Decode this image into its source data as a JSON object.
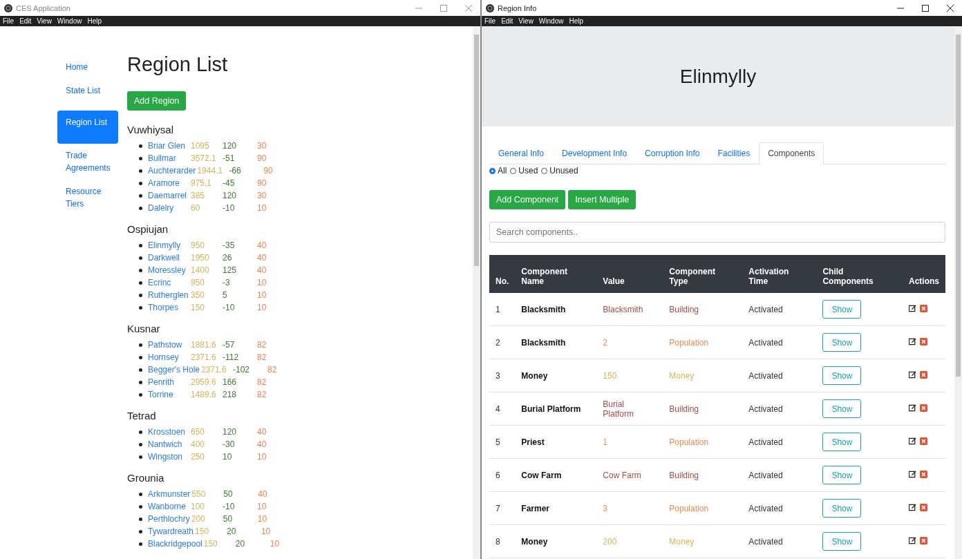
{
  "left_window": {
    "title": "CES Application",
    "menu": [
      "File",
      "Edit",
      "View",
      "Window",
      "Help"
    ],
    "nav": [
      {
        "label": "Home",
        "selected": false
      },
      {
        "label": "State List",
        "selected": false
      },
      {
        "label": "Region List",
        "selected": true
      },
      {
        "label": "Trade Agreements",
        "selected": false
      },
      {
        "label": "Resource Tiers",
        "selected": false
      }
    ],
    "heading": "Region List",
    "add_button": "Add Region",
    "states": [
      {
        "name": "Vuwhiysal",
        "regions": [
          {
            "name": "Briar Glen",
            "column_2": "1095",
            "column_3": "120",
            "column_4": "30"
          },
          {
            "name": "Bullmar",
            "column_2": "3572.1",
            "column_3": "-51",
            "column_4": "90"
          },
          {
            "name": "Auchterarder",
            "column_2": "1944.1",
            "column_3": "-66",
            "column_4": "90"
          },
          {
            "name": "Aramore",
            "column_2": "975.1",
            "column_3": "-45",
            "column_4": "90"
          },
          {
            "name": "Daemarrel",
            "column_2": "385",
            "column_3": "120",
            "column_4": "30"
          },
          {
            "name": "Dalelry",
            "column_2": "60",
            "column_3": "-10",
            "column_4": "10"
          }
        ]
      },
      {
        "name": "Ospiujan",
        "regions": [
          {
            "name": "Elinmylly",
            "column_2": "950",
            "column_3": "-35",
            "column_4": "40"
          },
          {
            "name": "Darkwell",
            "column_2": "1950",
            "column_3": "26",
            "column_4": "40"
          },
          {
            "name": "Moressley",
            "column_2": "1400",
            "column_3": "125",
            "column_4": "40"
          },
          {
            "name": "Ecrinc",
            "column_2": "950",
            "column_3": "-3",
            "column_4": "10"
          },
          {
            "name": "Rutherglen",
            "column_2": "350",
            "column_3": "5",
            "column_4": "10"
          },
          {
            "name": "Thorpes",
            "column_2": "150",
            "column_3": "-10",
            "column_4": "10"
          }
        ]
      },
      {
        "name": "Kusnar",
        "regions": [
          {
            "name": "Pathstow",
            "column_2": "1881.6",
            "column_3": "-57",
            "column_4": "82"
          },
          {
            "name": "Hornsey",
            "column_2": "2371.6",
            "column_3": "-112",
            "column_4": "82"
          },
          {
            "name": "Begger's Hole",
            "column_2": "2371.6",
            "column_3": "-102",
            "column_4": "82"
          },
          {
            "name": "Penrith",
            "column_2": "2959.6",
            "column_3": "166",
            "column_4": "82"
          },
          {
            "name": "Torrine",
            "column_2": "1489.6",
            "column_3": "218",
            "column_4": "82"
          }
        ]
      },
      {
        "name": "Tetrad",
        "regions": [
          {
            "name": "Krosstoen",
            "column_2": "650",
            "column_3": "120",
            "column_4": "40"
          },
          {
            "name": "Nantwich",
            "column_2": "400",
            "column_3": "-30",
            "column_4": "40"
          },
          {
            "name": "Wingston",
            "column_2": "250",
            "column_3": "10",
            "column_4": "10"
          }
        ]
      },
      {
        "name": "Grounia",
        "regions": [
          {
            "name": "Arkmunster",
            "column_2": "550",
            "column_3": "50",
            "column_4": "40"
          },
          {
            "name": "Wanborne",
            "column_2": "100",
            "column_3": "-10",
            "column_4": "10"
          },
          {
            "name": "Perthlochry",
            "column_2": "200",
            "column_3": "50",
            "column_4": "10"
          },
          {
            "name": "Tywardreath",
            "column_2": "150",
            "column_3": "20",
            "column_4": "10"
          },
          {
            "name": "Blackridgepool",
            "column_2": "150",
            "column_3": "20",
            "column_4": "10"
          }
        ]
      }
    ]
  },
  "right_window": {
    "title": "Region Info",
    "menu": [
      "File",
      "Edit",
      "View",
      "Window",
      "Help"
    ],
    "heading": "Elinmylly",
    "tabs": [
      {
        "label": "General Info",
        "selected": false
      },
      {
        "label": "Development Info",
        "selected": false
      },
      {
        "label": "Corruption Info",
        "selected": false
      },
      {
        "label": "Facilities",
        "selected": false
      },
      {
        "label": "Components",
        "selected": true
      }
    ],
    "filters": [
      {
        "label": "All",
        "selected": true
      },
      {
        "label": "Used",
        "selected": false
      },
      {
        "label": "Unused",
        "selected": false
      }
    ],
    "buttons": [
      "Add Component",
      "Insert Multiple"
    ],
    "search": {
      "placeholder": "Search components.."
    },
    "table": {
      "columns": [
        "No.",
        "Component Name",
        "Value",
        "Component Type",
        "Activation Time",
        "Child Components",
        "Actions"
      ],
      "rows": [
        {
          "no": "1",
          "name": "Blacksmith",
          "value": "Blacksmith",
          "type": "Building",
          "kind": "building",
          "activation": "Activated",
          "child": "Show"
        },
        {
          "no": "2",
          "name": "Blacksmith",
          "value": "2",
          "type": "Population",
          "kind": "population",
          "activation": "Activated",
          "child": "Show"
        },
        {
          "no": "3",
          "name": "Money",
          "value": "150",
          "type": "Money",
          "kind": "money",
          "activation": "Activated",
          "child": "Show"
        },
        {
          "no": "4",
          "name": "Burial Platform",
          "value": "Burial Platform",
          "type": "Building",
          "kind": "building",
          "activation": "Activated",
          "child": "Show"
        },
        {
          "no": "5",
          "name": "Priest",
          "value": "1",
          "type": "Population",
          "kind": "population",
          "activation": "Activated",
          "child": "Show"
        },
        {
          "no": "6",
          "name": "Cow Farm",
          "value": "Cow Farm",
          "type": "Building",
          "kind": "building",
          "activation": "Activated",
          "child": "Show"
        },
        {
          "no": "7",
          "name": "Farmer",
          "value": "3",
          "type": "Population",
          "kind": "population",
          "activation": "Activated",
          "child": "Show"
        },
        {
          "no": "8",
          "name": "Money",
          "value": "200",
          "type": "Money",
          "kind": "money",
          "activation": "Activated",
          "child": "Show"
        }
      ]
    }
  }
}
